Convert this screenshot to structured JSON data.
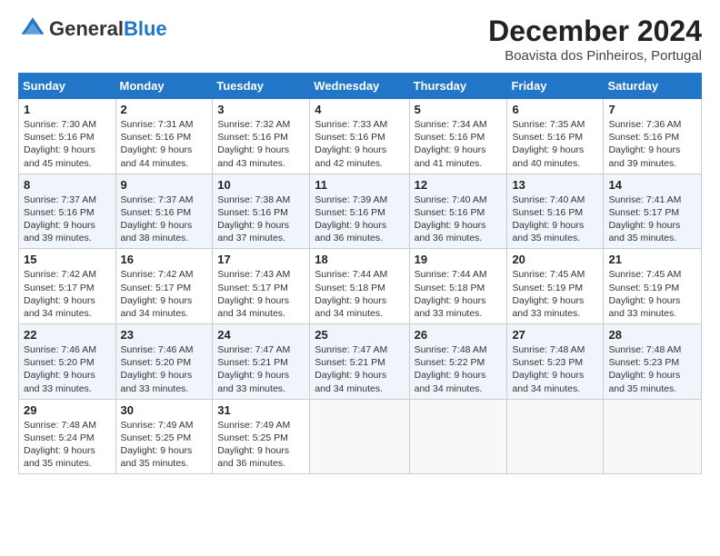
{
  "logo": {
    "general": "General",
    "blue": "Blue"
  },
  "title": "December 2024",
  "location": "Boavista dos Pinheiros, Portugal",
  "days_of_week": [
    "Sunday",
    "Monday",
    "Tuesday",
    "Wednesday",
    "Thursday",
    "Friday",
    "Saturday"
  ],
  "weeks": [
    [
      {
        "day": "1",
        "sunrise": "Sunrise: 7:30 AM",
        "sunset": "Sunset: 5:16 PM",
        "daylight": "Daylight: 9 hours and 45 minutes."
      },
      {
        "day": "2",
        "sunrise": "Sunrise: 7:31 AM",
        "sunset": "Sunset: 5:16 PM",
        "daylight": "Daylight: 9 hours and 44 minutes."
      },
      {
        "day": "3",
        "sunrise": "Sunrise: 7:32 AM",
        "sunset": "Sunset: 5:16 PM",
        "daylight": "Daylight: 9 hours and 43 minutes."
      },
      {
        "day": "4",
        "sunrise": "Sunrise: 7:33 AM",
        "sunset": "Sunset: 5:16 PM",
        "daylight": "Daylight: 9 hours and 42 minutes."
      },
      {
        "day": "5",
        "sunrise": "Sunrise: 7:34 AM",
        "sunset": "Sunset: 5:16 PM",
        "daylight": "Daylight: 9 hours and 41 minutes."
      },
      {
        "day": "6",
        "sunrise": "Sunrise: 7:35 AM",
        "sunset": "Sunset: 5:16 PM",
        "daylight": "Daylight: 9 hours and 40 minutes."
      },
      {
        "day": "7",
        "sunrise": "Sunrise: 7:36 AM",
        "sunset": "Sunset: 5:16 PM",
        "daylight": "Daylight: 9 hours and 39 minutes."
      }
    ],
    [
      {
        "day": "8",
        "sunrise": "Sunrise: 7:37 AM",
        "sunset": "Sunset: 5:16 PM",
        "daylight": "Daylight: 9 hours and 39 minutes."
      },
      {
        "day": "9",
        "sunrise": "Sunrise: 7:37 AM",
        "sunset": "Sunset: 5:16 PM",
        "daylight": "Daylight: 9 hours and 38 minutes."
      },
      {
        "day": "10",
        "sunrise": "Sunrise: 7:38 AM",
        "sunset": "Sunset: 5:16 PM",
        "daylight": "Daylight: 9 hours and 37 minutes."
      },
      {
        "day": "11",
        "sunrise": "Sunrise: 7:39 AM",
        "sunset": "Sunset: 5:16 PM",
        "daylight": "Daylight: 9 hours and 36 minutes."
      },
      {
        "day": "12",
        "sunrise": "Sunrise: 7:40 AM",
        "sunset": "Sunset: 5:16 PM",
        "daylight": "Daylight: 9 hours and 36 minutes."
      },
      {
        "day": "13",
        "sunrise": "Sunrise: 7:40 AM",
        "sunset": "Sunset: 5:16 PM",
        "daylight": "Daylight: 9 hours and 35 minutes."
      },
      {
        "day": "14",
        "sunrise": "Sunrise: 7:41 AM",
        "sunset": "Sunset: 5:17 PM",
        "daylight": "Daylight: 9 hours and 35 minutes."
      }
    ],
    [
      {
        "day": "15",
        "sunrise": "Sunrise: 7:42 AM",
        "sunset": "Sunset: 5:17 PM",
        "daylight": "Daylight: 9 hours and 34 minutes."
      },
      {
        "day": "16",
        "sunrise": "Sunrise: 7:42 AM",
        "sunset": "Sunset: 5:17 PM",
        "daylight": "Daylight: 9 hours and 34 minutes."
      },
      {
        "day": "17",
        "sunrise": "Sunrise: 7:43 AM",
        "sunset": "Sunset: 5:17 PM",
        "daylight": "Daylight: 9 hours and 34 minutes."
      },
      {
        "day": "18",
        "sunrise": "Sunrise: 7:44 AM",
        "sunset": "Sunset: 5:18 PM",
        "daylight": "Daylight: 9 hours and 34 minutes."
      },
      {
        "day": "19",
        "sunrise": "Sunrise: 7:44 AM",
        "sunset": "Sunset: 5:18 PM",
        "daylight": "Daylight: 9 hours and 33 minutes."
      },
      {
        "day": "20",
        "sunrise": "Sunrise: 7:45 AM",
        "sunset": "Sunset: 5:19 PM",
        "daylight": "Daylight: 9 hours and 33 minutes."
      },
      {
        "day": "21",
        "sunrise": "Sunrise: 7:45 AM",
        "sunset": "Sunset: 5:19 PM",
        "daylight": "Daylight: 9 hours and 33 minutes."
      }
    ],
    [
      {
        "day": "22",
        "sunrise": "Sunrise: 7:46 AM",
        "sunset": "Sunset: 5:20 PM",
        "daylight": "Daylight: 9 hours and 33 minutes."
      },
      {
        "day": "23",
        "sunrise": "Sunrise: 7:46 AM",
        "sunset": "Sunset: 5:20 PM",
        "daylight": "Daylight: 9 hours and 33 minutes."
      },
      {
        "day": "24",
        "sunrise": "Sunrise: 7:47 AM",
        "sunset": "Sunset: 5:21 PM",
        "daylight": "Daylight: 9 hours and 33 minutes."
      },
      {
        "day": "25",
        "sunrise": "Sunrise: 7:47 AM",
        "sunset": "Sunset: 5:21 PM",
        "daylight": "Daylight: 9 hours and 34 minutes."
      },
      {
        "day": "26",
        "sunrise": "Sunrise: 7:48 AM",
        "sunset": "Sunset: 5:22 PM",
        "daylight": "Daylight: 9 hours and 34 minutes."
      },
      {
        "day": "27",
        "sunrise": "Sunrise: 7:48 AM",
        "sunset": "Sunset: 5:23 PM",
        "daylight": "Daylight: 9 hours and 34 minutes."
      },
      {
        "day": "28",
        "sunrise": "Sunrise: 7:48 AM",
        "sunset": "Sunset: 5:23 PM",
        "daylight": "Daylight: 9 hours and 35 minutes."
      }
    ],
    [
      {
        "day": "29",
        "sunrise": "Sunrise: 7:48 AM",
        "sunset": "Sunset: 5:24 PM",
        "daylight": "Daylight: 9 hours and 35 minutes."
      },
      {
        "day": "30",
        "sunrise": "Sunrise: 7:49 AM",
        "sunset": "Sunset: 5:25 PM",
        "daylight": "Daylight: 9 hours and 35 minutes."
      },
      {
        "day": "31",
        "sunrise": "Sunrise: 7:49 AM",
        "sunset": "Sunset: 5:25 PM",
        "daylight": "Daylight: 9 hours and 36 minutes."
      },
      null,
      null,
      null,
      null
    ]
  ]
}
